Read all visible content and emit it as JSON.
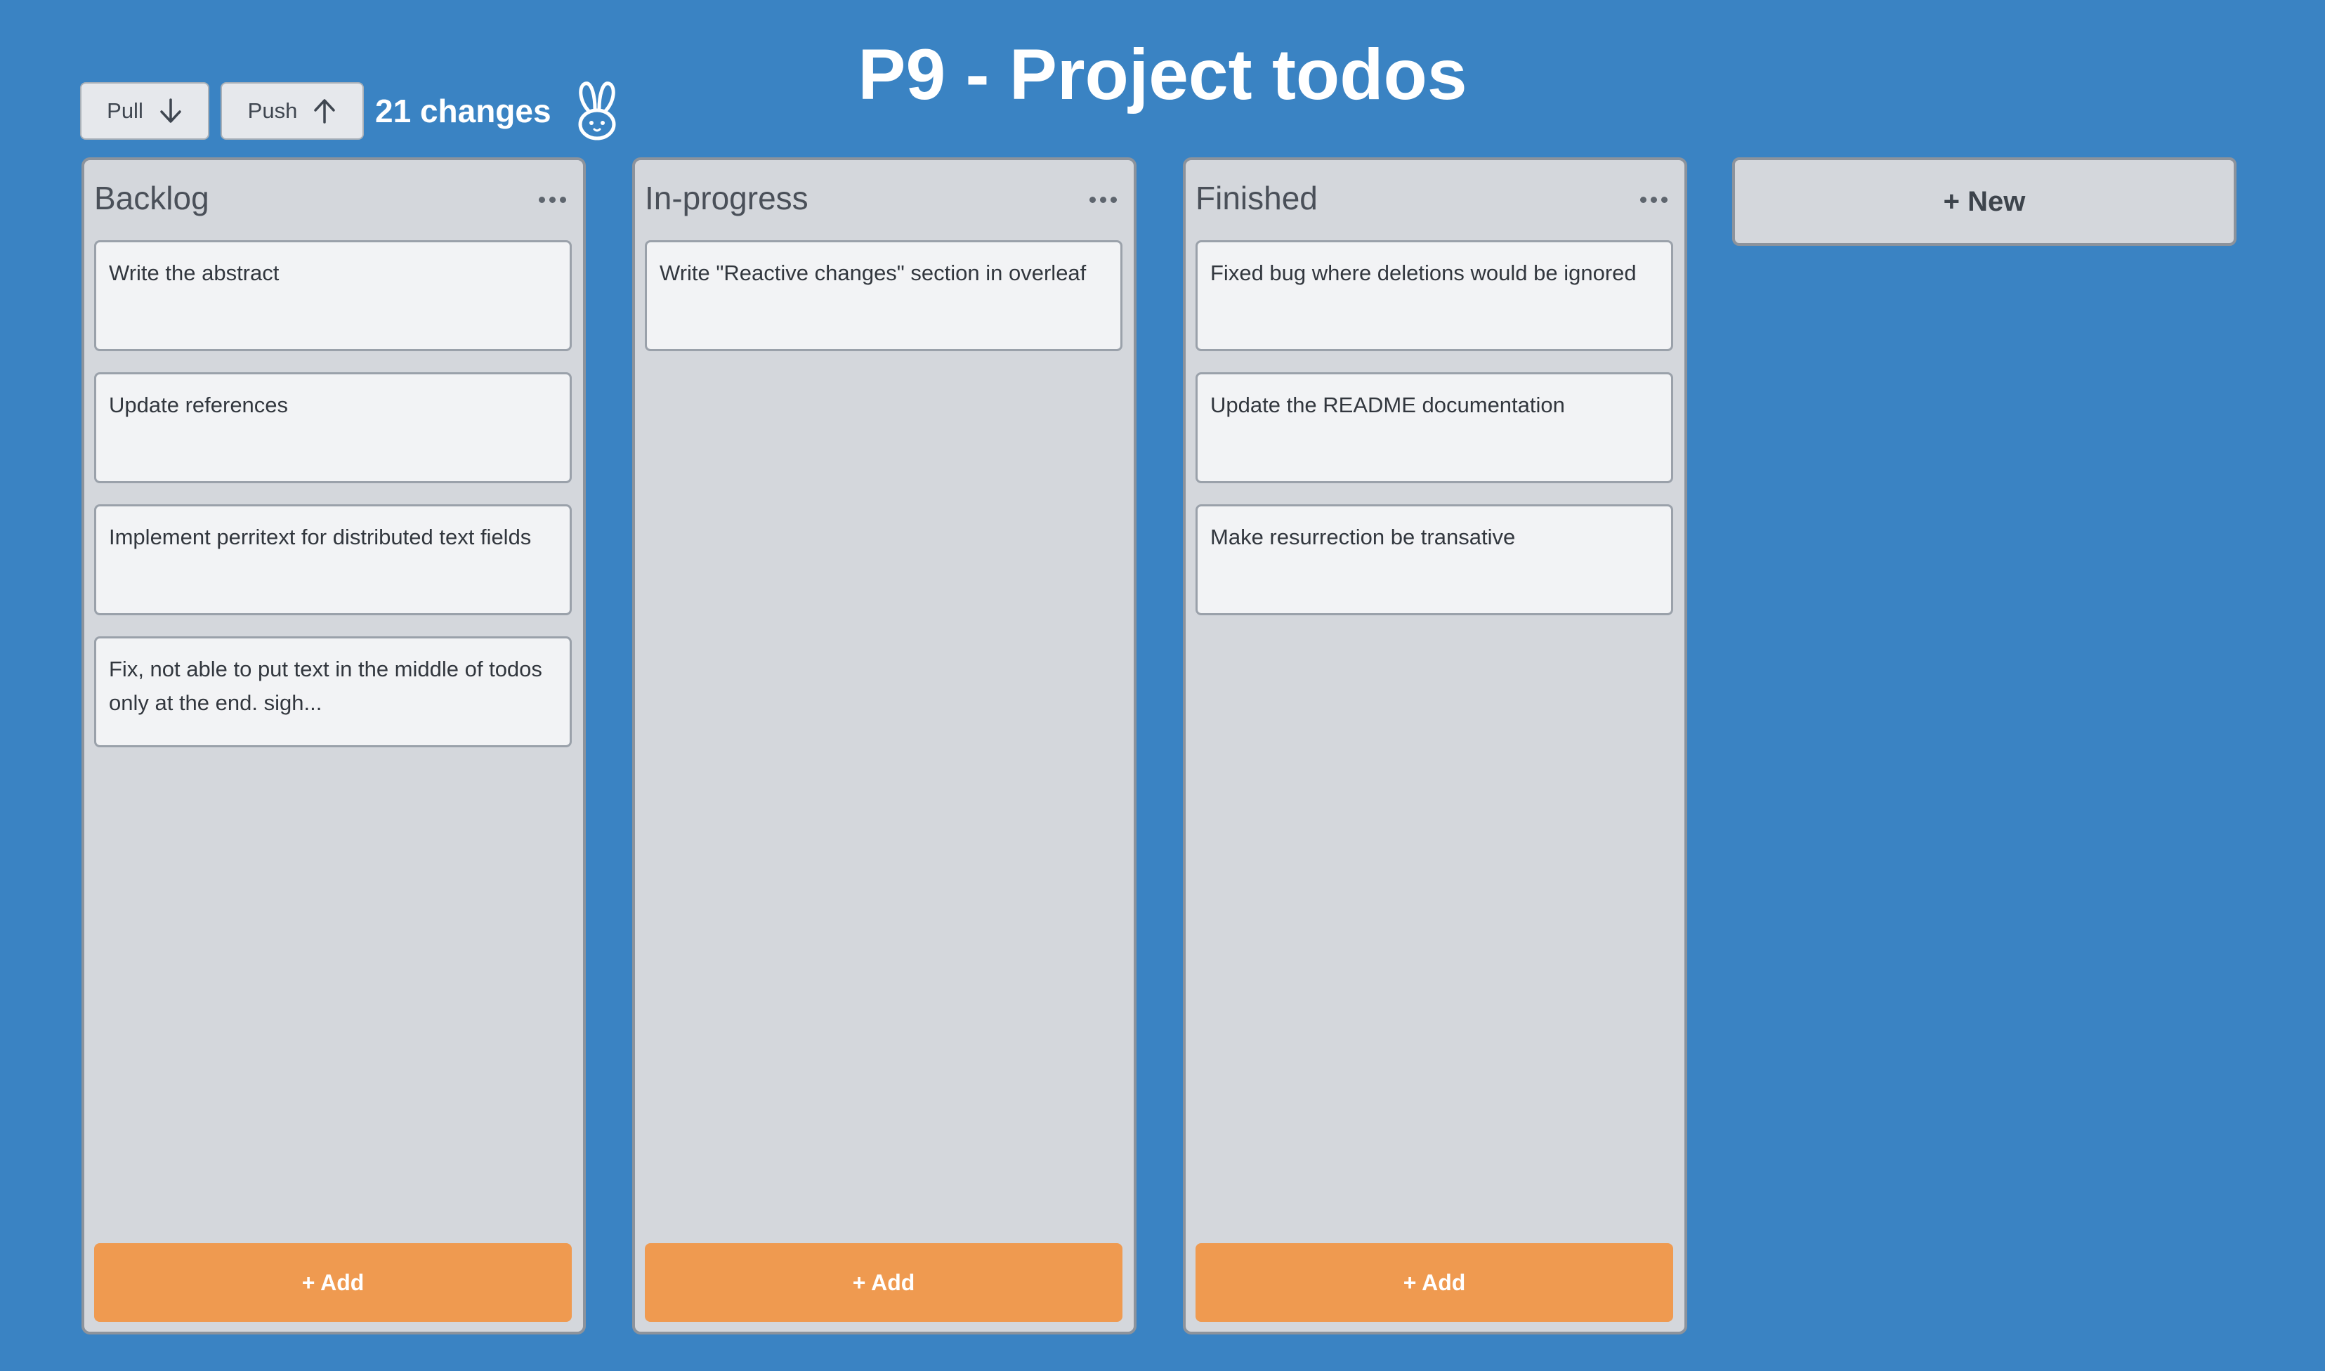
{
  "header": {
    "title": "P9 - Project todos",
    "pull_label": "Pull",
    "push_label": "Push",
    "changes_text": "21 changes"
  },
  "columns": [
    {
      "title": "Backlog",
      "add_label": "+ Add",
      "cards": [
        "Write the abstract",
        "Update references",
        "Implement perritext for distributed text fields",
        "Fix, not able to put text in the middle of todos only at the end. sigh..."
      ]
    },
    {
      "title": "In-progress",
      "add_label": "+ Add",
      "cards": [
        "Write \"Reactive changes\" section in overleaf"
      ]
    },
    {
      "title": "Finished",
      "add_label": "+ Add",
      "cards": [
        "Fixed bug where deletions would be ignored",
        "Update the README documentation",
        "Make resurrection be transative"
      ]
    }
  ],
  "new_column_label": "+ New",
  "icons": {
    "pull": "arrow-down-icon",
    "push": "arrow-up-icon",
    "logo": "rabbit-icon",
    "column_menu": "more-horizontal-icon"
  },
  "colors": {
    "background": "#3a83c3",
    "column": "#d4d7dc",
    "card": "#f2f3f5",
    "add_button": "#ef9a50",
    "title_text": "#ffffff"
  }
}
